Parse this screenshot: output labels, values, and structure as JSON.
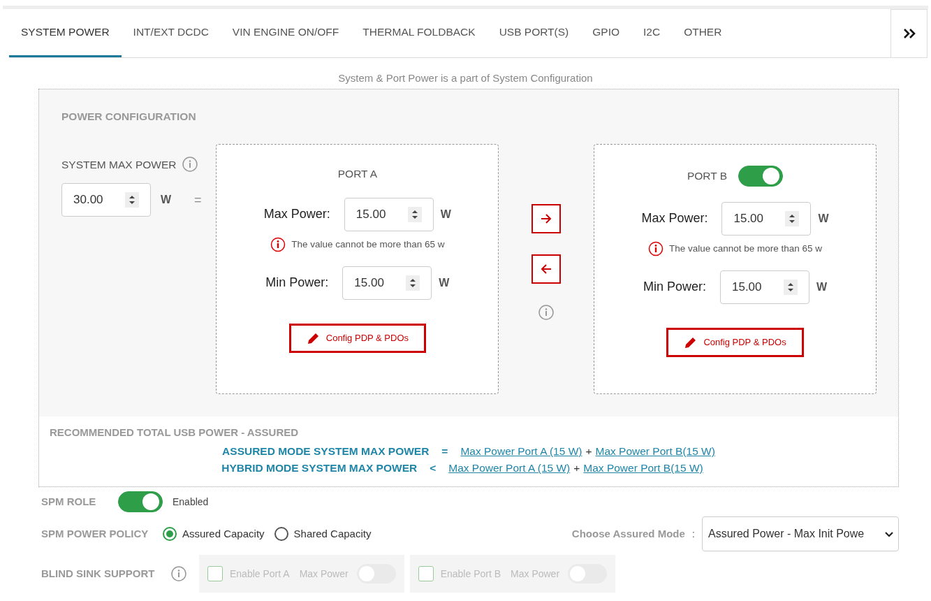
{
  "tabs": [
    {
      "label": "SYSTEM POWER",
      "selected": true
    },
    {
      "label": "INT/EXT DCDC",
      "selected": false
    },
    {
      "label": "VIN ENGINE ON/OFF",
      "selected": false
    },
    {
      "label": "THERMAL FOLDBACK",
      "selected": false
    },
    {
      "label": "USB PORT(S)",
      "selected": false
    },
    {
      "label": "GPIO",
      "selected": false
    },
    {
      "label": "I2C",
      "selected": false
    },
    {
      "label": "OTHER",
      "selected": false
    }
  ],
  "note": "System & Port Power is a part of System Configuration",
  "power_configuration": {
    "title": "POWER CONFIGURATION",
    "system_max_power": {
      "label": "SYSTEM MAX POWER",
      "value": "30.00",
      "unit": "W",
      "operator": "="
    },
    "ports": [
      {
        "label": "PORT A",
        "max_label": "Max Power:",
        "max_value": "15.00",
        "max_unit": "W",
        "warning": "The value cannot be more than 65 w",
        "min_label": "Min Power:",
        "min_value": "15.00",
        "min_unit": "W",
        "button": "Config PDP & PDOs"
      },
      {
        "label": "PORT B",
        "enabled": true,
        "max_label": "Max Power:",
        "max_value": "15.00",
        "max_unit": "W",
        "warning": "The value cannot be more than 65 w",
        "min_label": "Min Power:",
        "min_value": "15.00",
        "min_unit": "W",
        "button": "Config PDP & PDOs"
      }
    ]
  },
  "recommended": {
    "title": "RECOMMENDED TOTAL USB POWER - ASSURED",
    "rows": [
      {
        "label": "ASSURED MODE SYSTEM MAX POWER",
        "operator": "=",
        "link_a": "Max Power Port A (15 W)",
        "plus": "+",
        "link_b": "Max Power Port B(15 W)"
      },
      {
        "label": "HYBRID MODE SYSTEM MAX POWER",
        "operator": "<",
        "link_a": "Max Power Port A (15 W)",
        "plus": "+",
        "link_b": "Max Power Port B(15 W)"
      }
    ]
  },
  "spm_role": {
    "label": "SPM ROLE",
    "on": true,
    "status": "Enabled"
  },
  "spm_power_policy": {
    "label": "SPM POWER POLICY",
    "options": [
      {
        "label": "Assured Capacity",
        "selected": true
      },
      {
        "label": "Shared Capacity",
        "selected": false
      }
    ],
    "assured_mode": {
      "label": "Choose Assured Mode",
      "colon": ":",
      "value": "Assured Power - Max Init Powe"
    }
  },
  "blind_sink_support": {
    "label": "BLIND SINK SUPPORT",
    "disabled": true,
    "options": [
      {
        "label": "Enable Port A",
        "checked": false,
        "switch_label": "Max Power",
        "on": false
      },
      {
        "label": "Enable Port B",
        "checked": false,
        "switch_label": "Max Power",
        "on": false
      }
    ]
  }
}
